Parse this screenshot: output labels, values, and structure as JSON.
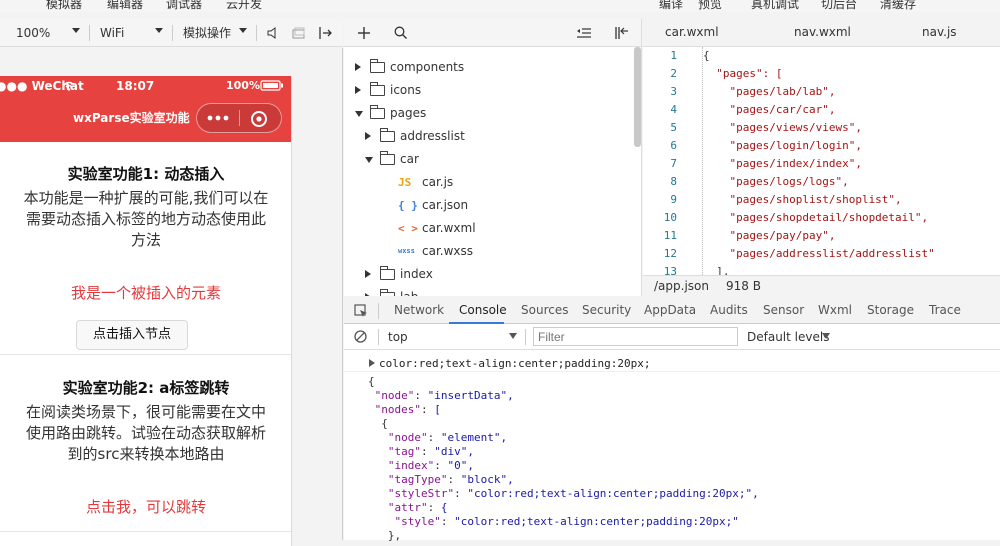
{
  "menubar": {
    "left_items": [
      "模拟器",
      "编辑器",
      "调试器",
      "云开发"
    ],
    "right_items": [
      "编译",
      "预览",
      "真机调试",
      "切后台",
      "清缓存"
    ]
  },
  "simulator_toolbar": {
    "zoom": "100%",
    "network": "WiFi",
    "operation": "模拟操作"
  },
  "phone": {
    "status": {
      "carrier": "●●● WeChat",
      "time": "18:07",
      "battery": "100%"
    },
    "nav_title": "wxParse实验室功能",
    "section1": {
      "title": "实验室功能1: 动态插入",
      "desc_lines": [
        "本功能是一种扩展的可能,我们可以在",
        "需要动态插入标签的地方动态使用此",
        "方法"
      ],
      "inserted_text": "我是一个被插入的元素",
      "button": "点击插入节点"
    },
    "section2": {
      "title": "实验室功能2: a标签跳转",
      "desc_lines": [
        "在阅读类场景下，很可能需要在文中",
        "使用路由跳转。试验在动态获取解析",
        "到的src来转换本地路由"
      ],
      "link_text": "点击我，可以跳转"
    }
  },
  "filetree": {
    "rows": [
      {
        "label": "components",
        "type": "folder",
        "state": "collapsed",
        "level": 0
      },
      {
        "label": "icons",
        "type": "folder",
        "state": "collapsed",
        "level": 0
      },
      {
        "label": "pages",
        "type": "folder",
        "state": "expanded",
        "level": 0
      },
      {
        "label": "addresslist",
        "type": "folder",
        "state": "collapsed",
        "level": 1
      },
      {
        "label": "car",
        "type": "folder",
        "state": "expanded",
        "level": 1
      },
      {
        "label": "car.js",
        "type": "js",
        "level": 2
      },
      {
        "label": "car.json",
        "type": "json",
        "level": 2
      },
      {
        "label": "car.wxml",
        "type": "wxml",
        "level": 2
      },
      {
        "label": "car.wxss",
        "type": "wxss",
        "level": 2
      },
      {
        "label": "index",
        "type": "folder",
        "state": "collapsed",
        "level": 1
      },
      {
        "label": "lab",
        "type": "folder",
        "state": "collapsed",
        "level": 1
      }
    ],
    "file_badges": {
      "js": "JS",
      "json": "{ }",
      "wxml": "< >",
      "wxss": "wxss"
    }
  },
  "editor": {
    "tabs": [
      "car.wxml",
      "nav.wxml",
      "nav.js"
    ],
    "lines": [
      {
        "n": "1",
        "text": "{"
      },
      {
        "n": "2",
        "text": "  \"pages\": ["
      },
      {
        "n": "3",
        "text": "    \"pages/lab/lab\","
      },
      {
        "n": "4",
        "text": "    \"pages/car/car\","
      },
      {
        "n": "5",
        "text": "    \"pages/views/views\","
      },
      {
        "n": "6",
        "text": "    \"pages/login/login\","
      },
      {
        "n": "7",
        "text": "    \"pages/index/index\","
      },
      {
        "n": "8",
        "text": "    \"pages/logs/logs\","
      },
      {
        "n": "9",
        "text": "    \"pages/shoplist/shoplist\","
      },
      {
        "n": "10",
        "text": "    \"pages/shopdetail/shopdetail\","
      },
      {
        "n": "11",
        "text": "    \"pages/pay/pay\","
      },
      {
        "n": "12",
        "text": "    \"pages/addresslist/addresslist\""
      },
      {
        "n": "13",
        "text": "  ],"
      }
    ],
    "status": {
      "file": "/app.json",
      "size": "918 B"
    }
  },
  "devtools": {
    "tabs": [
      "Network",
      "Console",
      "Sources",
      "Security",
      "AppData",
      "Audits",
      "Sensor",
      "Wxml",
      "Storage",
      "Trace"
    ],
    "active_tab": "Console",
    "context": "top",
    "filter_placeholder": "Filter",
    "levels": "Default levels",
    "log_line": "color:red;text-align:center;padding:20px;",
    "object_lines": [
      "{",
      " \"node\": \"insertData\",",
      " \"nodes\": [",
      "  {",
      "   \"node\": \"element\",",
      "   \"tag\": \"div\",",
      "   \"index\": \"0\",",
      "   \"tagType\": \"block\",",
      "   \"styleStr\": \"color:red;text-align:center;padding:20px;\",",
      "   \"attr\": {",
      "    \"style\": \"color:red;text-align:center;padding:20px;\"",
      "   },"
    ]
  }
}
